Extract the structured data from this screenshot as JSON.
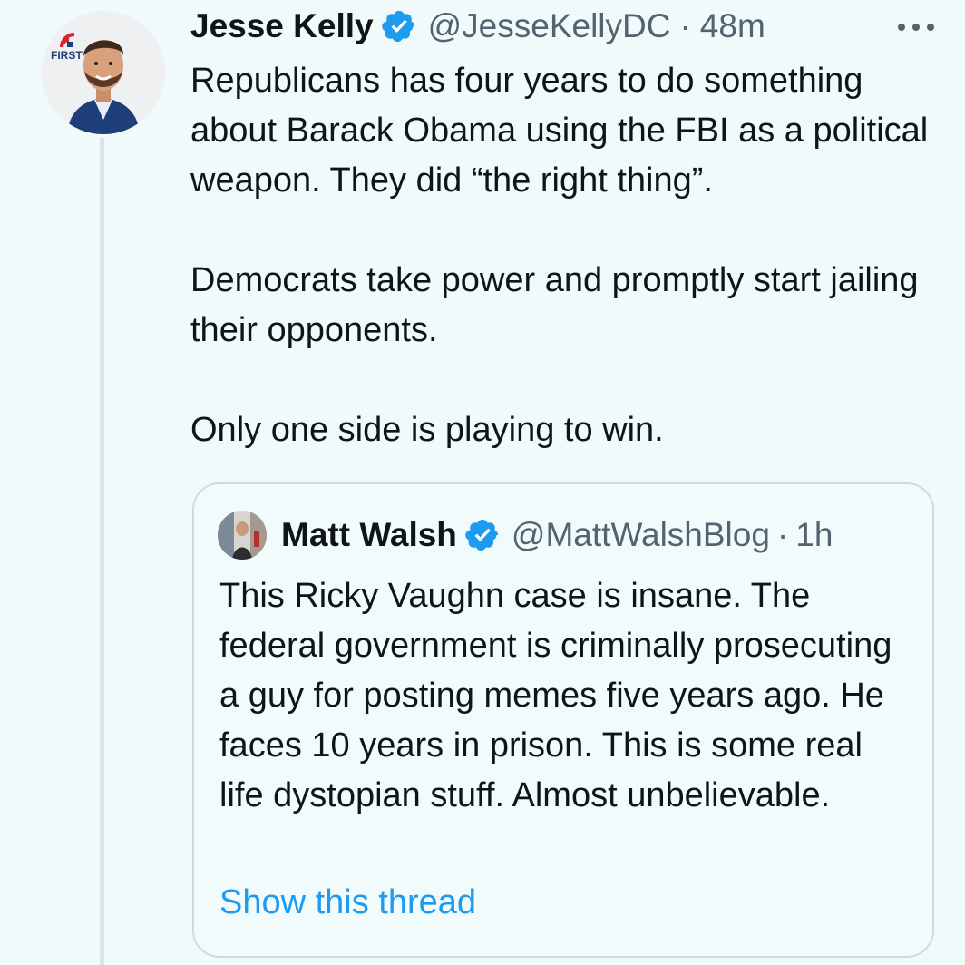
{
  "tweet": {
    "author_name": "Jesse Kelly",
    "handle": "@JesseKellyDC",
    "separator": "·",
    "time": "48m",
    "avatar_badge_text": "FIRST",
    "paragraphs": [
      "Republicans has four years to do something about Barack Obama using the FBI as a political weapon. They did “the right thing”.",
      "Democrats take power and promptly start jailing their opponents.",
      "Only one side is playing to win."
    ]
  },
  "quoted_tweet": {
    "author_name": "Matt Walsh",
    "handle": "@MattWalshBlog",
    "separator": "·",
    "time": "1h",
    "text": "This Ricky Vaughn case is insane. The federal government is criminally prosecuting a guy for posting memes five years ago. He faces 10 years in prison. This is some real life dystopian stuff. Almost unbelievable.",
    "show_thread_label": "Show this thread"
  },
  "icons": {
    "verified": "verified-badge-icon",
    "more": "more-options-icon"
  },
  "colors": {
    "background": "#f0fafb",
    "accent": "#1d9bf0",
    "secondary_text": "#536471",
    "border": "#cfd9de"
  }
}
